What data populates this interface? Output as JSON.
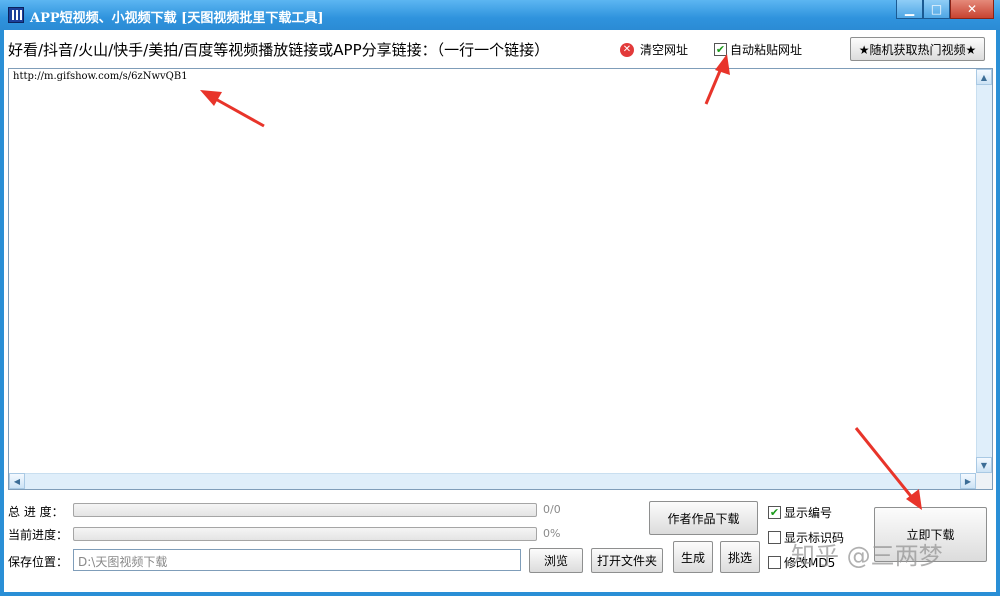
{
  "window": {
    "title": "APP短视频、小视频下载 [天图视频批里下载工具]",
    "controls": {
      "minimize": "▁",
      "maximize": "□",
      "close": "✕"
    }
  },
  "toolbar": {
    "links_label": "好看/抖音/火山/快手/美拍/百度等视频播放链接或APP分享链接：（一行一个链接）",
    "clear_label": "清空网址",
    "auto_paste_label": "自动粘贴网址",
    "auto_paste_checked": true,
    "hot_video_label": "★随机获取热门视频★"
  },
  "url_list": {
    "text": "http://m.gifshow.com/s/6zNwvQB1"
  },
  "progress": {
    "total_label": "总  进  度：",
    "total_value_text": "0/0",
    "total_fraction": 0,
    "current_label": "当前进度：",
    "current_value_text": "0%",
    "current_fraction": 0
  },
  "save": {
    "label": "保存位置：",
    "path": "D:\\天图视频下载",
    "browse_label": "浏览",
    "open_folder_label": "打开文件夹"
  },
  "actions": {
    "author_download_label": "作者作品下载",
    "generate_label": "生成",
    "pick_label": "挑选",
    "download_now_label": "立即下载"
  },
  "options": {
    "show_number_label": "显示编号",
    "show_number_checked": true,
    "show_mark_label": "显示标识码",
    "show_mark_checked": false,
    "md5_label": "修改MD5",
    "md5_checked": false
  },
  "watermark": "知乎 @三两梦",
  "colors": {
    "titlebar": "#2f93dd",
    "annotation_arrow": "#e8342a",
    "check": "#1a9a1a"
  }
}
